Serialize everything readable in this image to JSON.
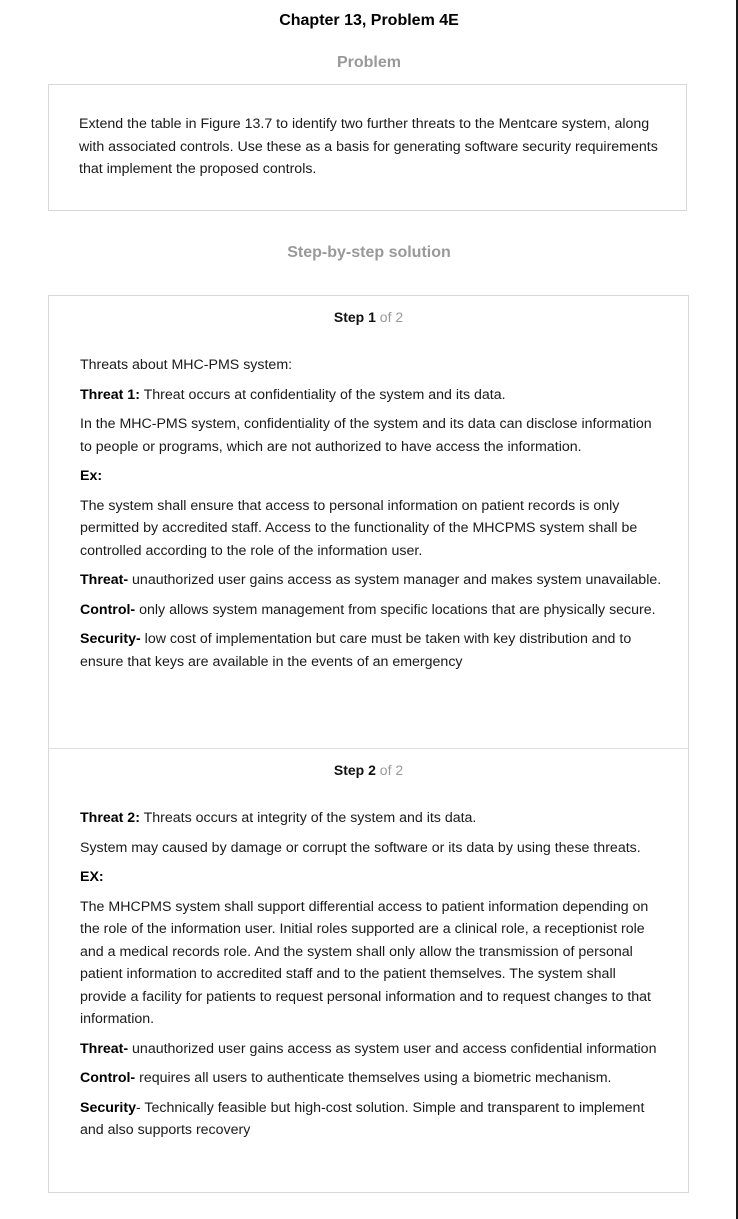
{
  "page_title": "Chapter 13, Problem 4E",
  "problem": {
    "heading": "Problem",
    "text": "Extend the table in Figure 13.7 to identify two further threats to the Mentcare system, along with associated controls. Use these as a basis for generating software security requirements that implement the proposed controls."
  },
  "solution": {
    "heading": "Step-by-step solution",
    "steps": [
      {
        "word": "Step",
        "number": "1",
        "of": "of 2",
        "intro": "Threats about MHC-PMS system:",
        "threat_label": "Threat 1:",
        "threat_text": " Threat occurs at confidentiality of the system and its data.",
        "desc": "In the MHC-PMS system, confidentiality of the system and its data can disclose information to people or programs, which are not authorized to have access the information.",
        "ex_label": "Ex:",
        "ex_text": "The system shall ensure that access to personal information on patient records is only permitted by accredited staff. Access to the functionality of the MHCPMS system shall be controlled according to the role of the information user.",
        "threat2_label": "Threat-",
        "threat2_text": " unauthorized user gains access as system manager and makes system unavailable.",
        "control_label": "Control-",
        "control_text": " only allows system management from specific locations that are physically secure.",
        "security_label": "Security-",
        "security_text": " low cost of implementation but care must be taken with key distribution and to ensure that keys are available in the events of an emergency"
      },
      {
        "word": "Step",
        "number": "2",
        "of": "of 2",
        "threat_label": "Threat 2:",
        "threat_text": " Threats occurs at integrity of the system and its data.",
        "desc": "System may caused by damage or corrupt the software or its data by using these threats.",
        "ex_label": "EX:",
        "ex_text": "The MHCPMS system shall support differential access to patient information depending on the role of the information user. Initial roles supported are a clinical role, a receptionist role and a medical records role. And the system shall only allow the transmission of personal patient information to accredited staff and to the patient themselves. The system shall provide a facility for patients to request personal information and to request changes to that information.",
        "threat2_label": "Threat-",
        "threat2_text": " unauthorized user gains access as system user and access confidential information",
        "control_label": "Control-",
        "control_text": " requires all users to authenticate themselves using a biometric mechanism.",
        "security_label": "Security",
        "security_text": "- Technically feasible but high-cost solution. Simple and transparent to implement and also supports recovery"
      }
    ]
  }
}
